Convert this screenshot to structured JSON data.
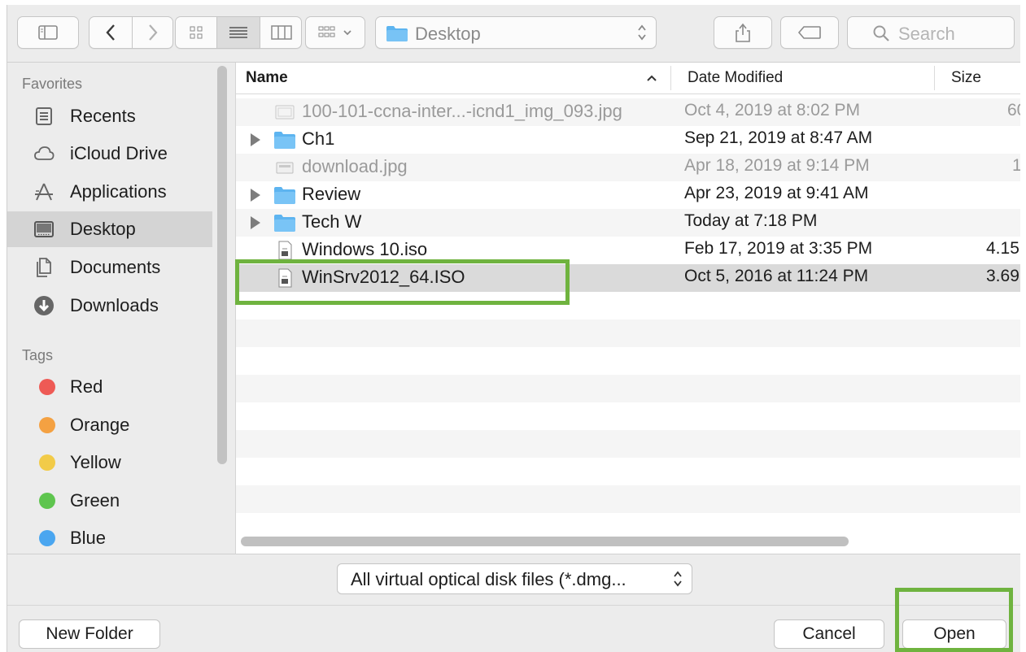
{
  "toolbar": {
    "path": "Desktop",
    "search_placeholder": "Search"
  },
  "sidebar": {
    "favorites_header": "Favorites",
    "favorites": [
      {
        "label": "Recents",
        "icon": "recents-icon"
      },
      {
        "label": "iCloud Drive",
        "icon": "cloud-icon"
      },
      {
        "label": "Applications",
        "icon": "applications-icon"
      },
      {
        "label": "Desktop",
        "icon": "desktop-icon",
        "selected": true
      },
      {
        "label": "Documents",
        "icon": "documents-icon"
      },
      {
        "label": "Downloads",
        "icon": "downloads-icon"
      }
    ],
    "tags_header": "Tags",
    "tags": [
      {
        "label": "Red",
        "color": "#ee5a55"
      },
      {
        "label": "Orange",
        "color": "#f4a142"
      },
      {
        "label": "Yellow",
        "color": "#f2cb48"
      },
      {
        "label": "Green",
        "color": "#5ec54e"
      },
      {
        "label": "Blue",
        "color": "#4aa6f0"
      }
    ]
  },
  "list": {
    "columns": {
      "name": "Name",
      "date": "Date Modified",
      "size": "Size"
    },
    "rows": [
      {
        "name": "100-101-ccna-inter...-icnd1_img_093.jpg",
        "date": "Oct 4, 2019 at 8:02 PM",
        "size": "60",
        "kind": "image",
        "dimmed": true
      },
      {
        "name": "Ch1",
        "date": "Sep 21, 2019 at 8:47 AM",
        "size": "",
        "kind": "folder"
      },
      {
        "name": "download.jpg",
        "date": "Apr 18, 2019 at 9:14 PM",
        "size": "1",
        "kind": "image",
        "dimmed": true
      },
      {
        "name": "Review",
        "date": "Apr 23, 2019 at 9:41 AM",
        "size": "",
        "kind": "folder"
      },
      {
        "name": "Tech W",
        "date": "Today at 7:18 PM",
        "size": "",
        "kind": "folder"
      },
      {
        "name": "Windows 10.iso",
        "date": "Feb 17, 2019 at 3:35 PM",
        "size": "4.15",
        "kind": "iso"
      },
      {
        "name": "WinSrv2012_64.ISO",
        "date": "Oct 5, 2016 at 11:24 PM",
        "size": "3.69",
        "kind": "iso",
        "selected": true
      }
    ]
  },
  "bottom": {
    "filter": "All virtual optical disk files (*.dmg...",
    "new_folder": "New Folder",
    "cancel": "Cancel",
    "open": "Open"
  },
  "colors": {
    "highlight": "#6fb33f",
    "folder": "#5db4f0"
  }
}
